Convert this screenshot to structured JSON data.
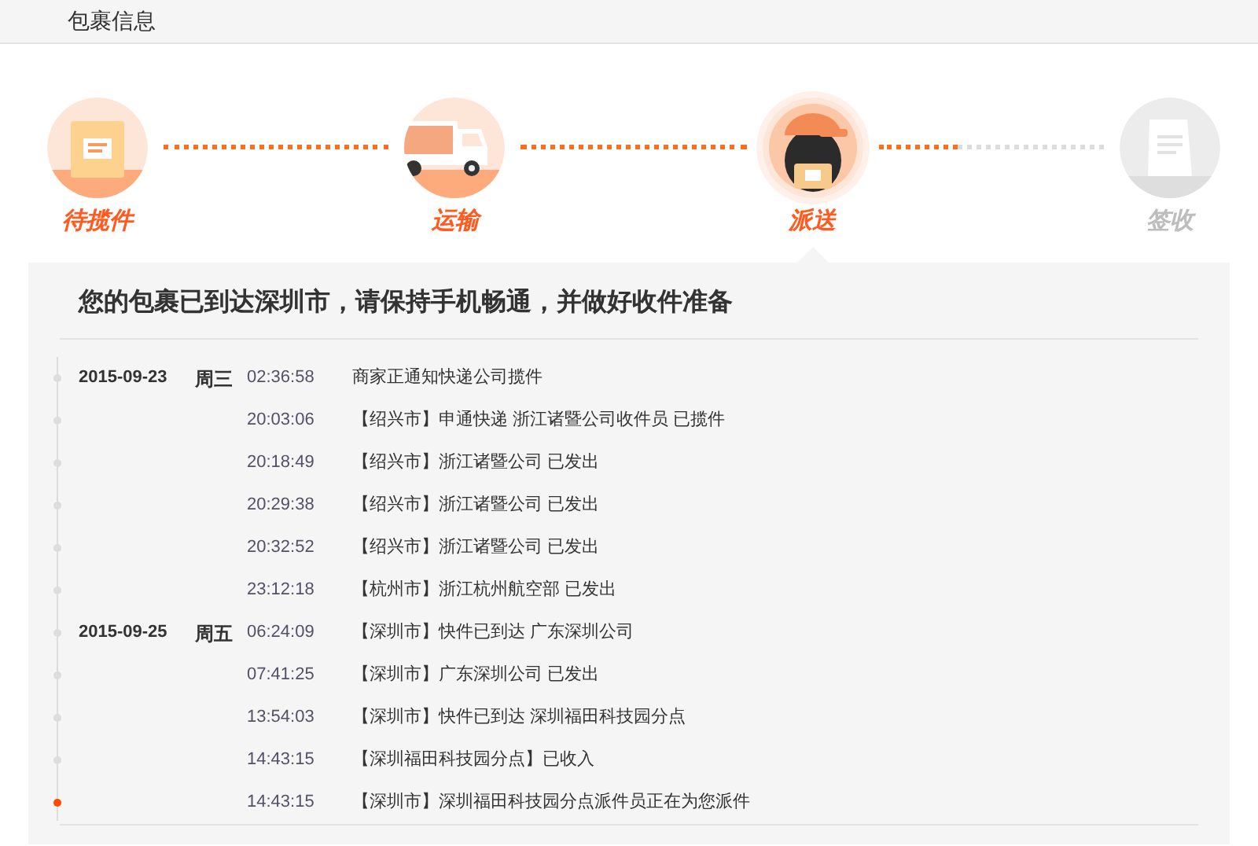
{
  "header": {
    "title": "包裹信息"
  },
  "steps": [
    {
      "label": "待揽件",
      "kind": "box",
      "reached": true,
      "current": false
    },
    {
      "label": "运输",
      "kind": "truck",
      "reached": true,
      "current": false
    },
    {
      "label": "派送",
      "kind": "courier",
      "reached": true,
      "current": true
    },
    {
      "label": "签收",
      "kind": "receipt",
      "reached": false,
      "current": false
    }
  ],
  "connectors": [
    {
      "level": 1
    },
    {
      "level": 1
    },
    {
      "level": 0.35
    }
  ],
  "panel": {
    "title": "您的包裹已到达深圳市，请保持手机畅通，并做好收件准备"
  },
  "events": [
    {
      "date": "2015-09-23",
      "weekday": "周三",
      "time": "02:36:58",
      "text": "商家正通知快递公司揽件",
      "latest": false
    },
    {
      "time": "20:03:06",
      "text": "【绍兴市】申通快递 浙江诸暨公司收件员 已揽件",
      "latest": false
    },
    {
      "time": "20:18:49",
      "text": "【绍兴市】浙江诸暨公司 已发出",
      "latest": false
    },
    {
      "time": "20:29:38",
      "text": "【绍兴市】浙江诸暨公司 已发出",
      "latest": false
    },
    {
      "time": "20:32:52",
      "text": "【绍兴市】浙江诸暨公司 已发出",
      "latest": false
    },
    {
      "time": "23:12:18",
      "text": "【杭州市】浙江杭州航空部 已发出",
      "latest": false
    },
    {
      "date": "2015-09-25",
      "weekday": "周五",
      "time": "06:24:09",
      "text": "【深圳市】快件已到达 广东深圳公司",
      "latest": false
    },
    {
      "time": "07:41:25",
      "text": "【深圳市】广东深圳公司 已发出",
      "latest": false
    },
    {
      "time": "13:54:03",
      "text": "【深圳市】快件已到达 深圳福田科技园分点",
      "latest": false
    },
    {
      "time": "14:43:15",
      "text": "【深圳福田科技园分点】已收入",
      "latest": false
    },
    {
      "time": "14:43:15",
      "text": "【深圳市】深圳福田科技园分点派件员正在为您派件",
      "latest": true
    }
  ]
}
